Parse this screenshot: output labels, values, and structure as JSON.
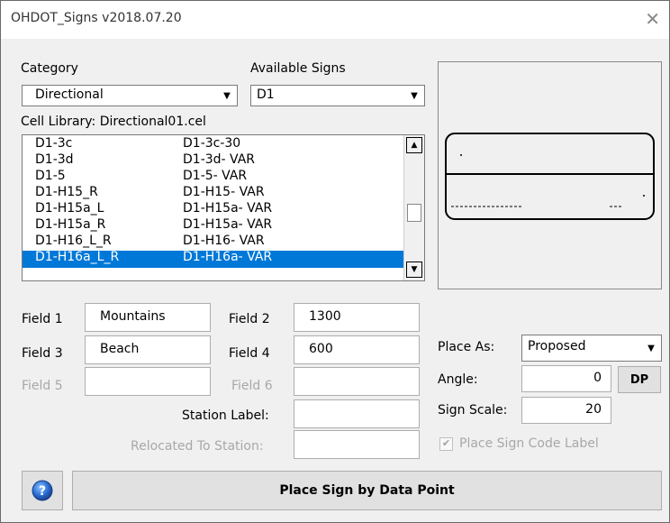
{
  "window": {
    "title": "OHDOT_Signs v2018.07.20",
    "close_glyph": "✕"
  },
  "category": {
    "label": "Category",
    "value": "Directional"
  },
  "available": {
    "label": "Available Signs",
    "value": "D1"
  },
  "cell_library": "Cell Library:  Directional01.cel",
  "list": {
    "rows": [
      {
        "a": "D1-3c",
        "b": "D1-3c-30"
      },
      {
        "a": "D1-3d",
        "b": "D1-3d- VAR"
      },
      {
        "a": "D1-5",
        "b": "D1-5- VAR"
      },
      {
        "a": "D1-H15_R",
        "b": "D1-H15- VAR"
      },
      {
        "a": "D1-H15a_L",
        "b": "D1-H15a- VAR"
      },
      {
        "a": "D1-H15a_R",
        "b": "D1-H15a- VAR"
      },
      {
        "a": "D1-H16_L_R",
        "b": "D1-H16- VAR"
      },
      {
        "a": "D1-H16a_L_R",
        "b": "D1-H16a- VAR"
      }
    ],
    "selected_index": 7
  },
  "fields": {
    "field1": {
      "label": "Field 1",
      "value": "Mountains"
    },
    "field2": {
      "label": "Field 2",
      "value": "1300"
    },
    "field3": {
      "label": "Field 3",
      "value": "Beach"
    },
    "field4": {
      "label": "Field 4",
      "value": "600"
    },
    "field5": {
      "label": "Field 5",
      "value": ""
    },
    "field6": {
      "label": "Field 6",
      "value": ""
    },
    "station_label": {
      "label": "Station Label:",
      "value": ""
    },
    "relocated": {
      "label": "Relocated To Station:",
      "value": ""
    }
  },
  "place_as": {
    "label": "Place As:",
    "value": "Proposed"
  },
  "angle": {
    "label": "Angle:",
    "value": "0",
    "button": "DP"
  },
  "sign_scale": {
    "label": "Sign Scale:",
    "value": "20"
  },
  "sign_code": {
    "label": "Place Sign Code Label",
    "checked": true
  },
  "place_button": "Place Sign by Data Point",
  "help_icon": "question-mark",
  "colors": {
    "selection": "#0078d7",
    "help": "#2b6fd6"
  }
}
